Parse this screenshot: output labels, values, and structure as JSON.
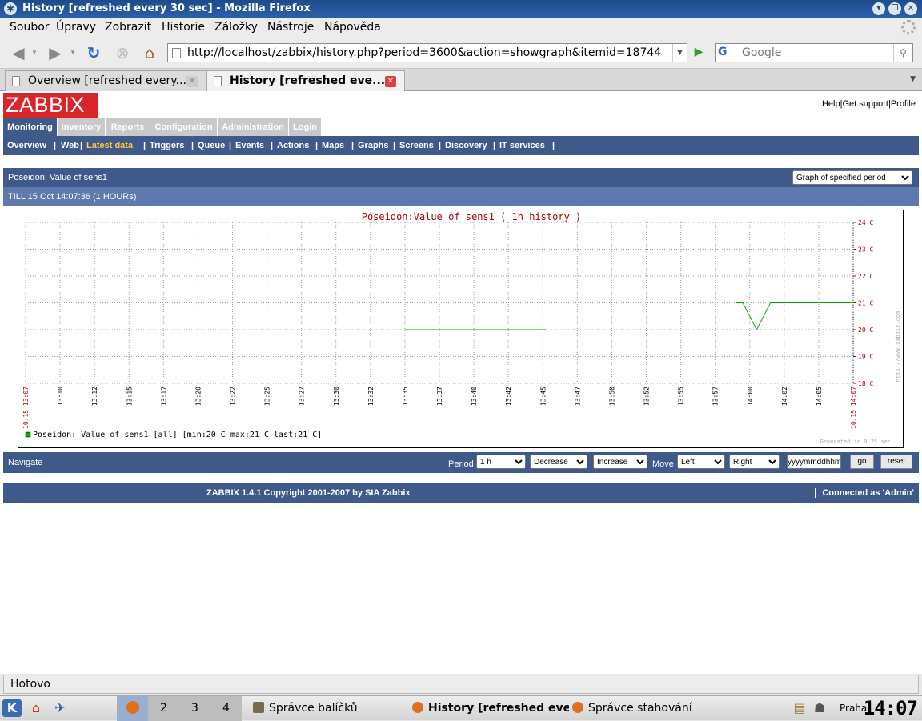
{
  "window": {
    "title": "History [refreshed every 30 sec] - Mozilla Firefox"
  },
  "menubar": [
    "Soubor",
    "Úpravy",
    "Zobrazit",
    "Historie",
    "Záložky",
    "Nástroje",
    "Nápověda"
  ],
  "navbar": {
    "url": "http://localhost/zabbix/history.php?period=3600&action=showgraph&itemid=18744",
    "search_placeholder": "Google",
    "search_engine": "G"
  },
  "tabs": [
    {
      "label": "Overview [refreshed every..."
    },
    {
      "label": "History [refreshed eve..."
    }
  ],
  "zabbix": {
    "logo": "ZABBIX",
    "toplinks": [
      "Help",
      "Get support",
      "Profile"
    ],
    "main_menu": [
      "Monitoring",
      "Inventory",
      "Reports",
      "Configuration",
      "Administration",
      "Login"
    ],
    "sub_menu": [
      "Overview",
      "Web",
      "Latest data",
      "Triggers",
      "Queue",
      "Events",
      "Actions",
      "Maps",
      "Graphs",
      "Screens",
      "Discovery",
      "IT services"
    ],
    "header": "Poseidon: Value of sens1",
    "view_select": "Graph of specified period",
    "till": "TILL 15 Oct 14:07:36 (1 HOURs)",
    "navigate": {
      "label": "Navigate",
      "period_label": "Period",
      "period_value": "1 h",
      "decrease": "Decrease",
      "increase": "Increase",
      "move_label": "Move",
      "left": "Left",
      "right": "Right",
      "date_value": "yyyymmddhhmm",
      "go": "go",
      "reset": "reset"
    },
    "footer": {
      "copyright": "ZABBIX 1.4.1 Copyright 2001-2007 by  SIA Zabbix",
      "connected": "Connected as 'Admin'"
    }
  },
  "chart_data": {
    "type": "line",
    "title": "Poseidon:Value of sens1 ( 1h history )",
    "y_ticks": [
      "18 C",
      "19 C",
      "20 C",
      "21 C",
      "22 C",
      "23 C",
      "24 C"
    ],
    "ylim": [
      18,
      24
    ],
    "x_start_label": "10.15 13:07",
    "x_end_label": "10.15 14:07",
    "x_tick_labels": [
      "13:10",
      "13:12",
      "13:15",
      "13:17",
      "13:20",
      "13:22",
      "13:25",
      "13:27",
      "13:30",
      "13:32",
      "13:35",
      "13:37",
      "13:40",
      "13:42",
      "13:45",
      "13:47",
      "13:50",
      "13:52",
      "13:55",
      "13:57",
      "14:00",
      "14:02",
      "14:05"
    ],
    "series": [
      {
        "name": "Poseidon: Value of sens1",
        "color": "#00aa00",
        "segments": [
          [
            [
              11.0,
              20
            ],
            [
              15.1,
              20
            ]
          ],
          [
            [
              20.6,
              21
            ],
            [
              20.8,
              21
            ],
            [
              21.2,
              20
            ],
            [
              21.6,
              21
            ],
            [
              24.0,
              21
            ]
          ]
        ]
      }
    ],
    "legend": "Poseidon: Value of sens1 [all] [min:20 C max:21 C last:21 C]",
    "side_url": "http://www.zabbix.com",
    "generated": "Generated in 0.25 sec",
    "grid": true
  },
  "status": "Hotovo",
  "taskbar": {
    "desktops": [
      "2",
      "3",
      "4"
    ],
    "tasks": [
      "Správce balíčků",
      "History [refreshed every",
      "Správce stahování"
    ],
    "city": "Praha",
    "clock": "14:07"
  },
  "colors": {
    "zabbix_blue": "#3f5a8a",
    "zabbix_red": "#d9262b",
    "graph_line": "#00aa00",
    "graph_title": "#aa0000"
  }
}
